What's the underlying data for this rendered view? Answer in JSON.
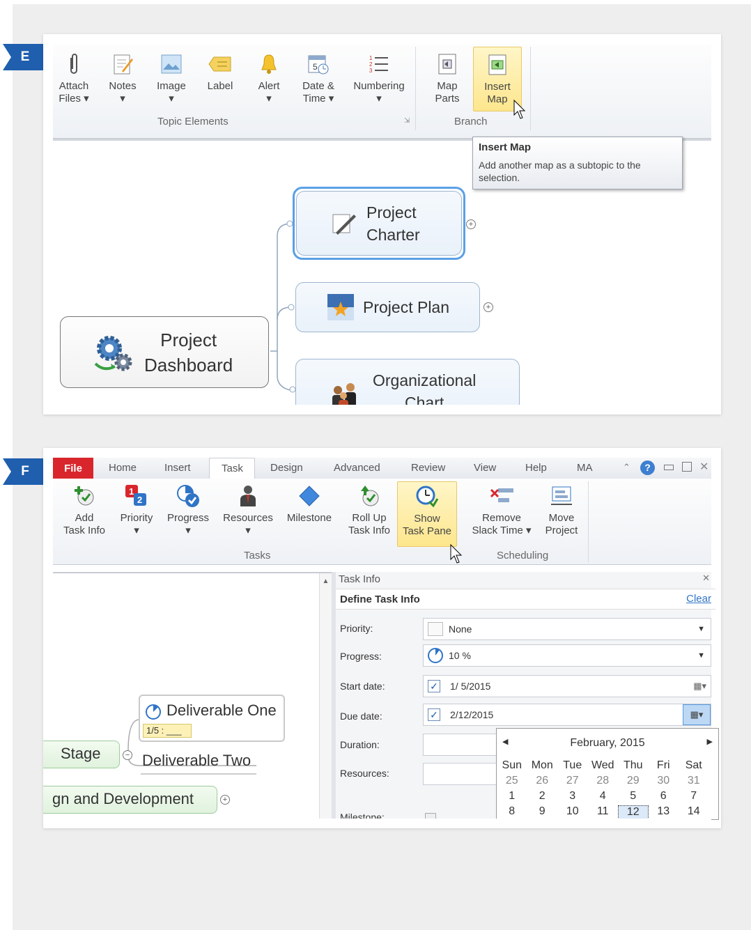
{
  "panel_e": {
    "tag": "E",
    "ribbon_buttons": [
      {
        "l1": "Attach",
        "l2": "Files ▾"
      },
      {
        "l1": "Notes",
        "l2": "▾"
      },
      {
        "l1": "Image",
        "l2": "▾"
      },
      {
        "l1": "Label",
        "l2": ""
      },
      {
        "l1": "Alert",
        "l2": "▾"
      },
      {
        "l1": "Date &",
        "l2": "Time ▾"
      },
      {
        "l1": "Numbering",
        "l2": "▾"
      },
      {
        "l1": "Map",
        "l2": "Parts"
      },
      {
        "l1": "Insert",
        "l2": "Map"
      }
    ],
    "group_topic_elements": "Topic Elements",
    "group_branch": "Branch",
    "tooltip_title": "Insert Map",
    "tooltip_line1": "Add another map as a subtopic to the",
    "tooltip_line2": "selection.",
    "topic_charter_1": "Project",
    "topic_charter_2": "Charter",
    "topic_plan": "Project Plan",
    "topic_dashboard_1": "Project",
    "topic_dashboard_2": "Dashboard",
    "topic_org_1": "Organizational",
    "topic_org_2": "Chart"
  },
  "panel_f": {
    "tag": "F",
    "tabs": [
      "File",
      "Home",
      "Insert",
      "Task",
      "Design",
      "Advanced",
      "Review",
      "View",
      "Help",
      "MA"
    ],
    "ribbon_buttons": [
      {
        "l1": "Add",
        "l2": "Task Info"
      },
      {
        "l1": "Priority",
        "l2": "▾"
      },
      {
        "l1": "Progress",
        "l2": "▾"
      },
      {
        "l1": "Resources",
        "l2": "▾"
      },
      {
        "l1": "Milestone",
        "l2": ""
      },
      {
        "l1": "Roll Up",
        "l2": "Task Info"
      },
      {
        "l1": "Show",
        "l2": "Task Pane"
      },
      {
        "l1": "Remove",
        "l2": "Slack Time ▾"
      },
      {
        "l1": "Move",
        "l2": "Project"
      }
    ],
    "group_tasks": "Tasks",
    "group_scheduling": "Scheduling",
    "pane_title": "Task Info",
    "pane_section": "Define Task Info",
    "pane_clear": "Clear",
    "fields": {
      "priority_label": "Priority:",
      "priority_value": "None",
      "progress_label": "Progress:",
      "progress_value": "10 %",
      "start_label": "Start date:",
      "start_value": "1/  5/2015",
      "due_label": "Due date:",
      "due_value": "2/12/2015",
      "duration_label": "Duration:",
      "resources_label": "Resources:",
      "milestone_label": "Milestone:"
    },
    "calendar": {
      "month": "February, 2015",
      "days": [
        "Sun",
        "Mon",
        "Tue",
        "Wed",
        "Thu",
        "Fri",
        "Sat"
      ],
      "week1": [
        "25",
        "26",
        "27",
        "28",
        "29",
        "30",
        "31"
      ],
      "week2": [
        "1",
        "2",
        "3",
        "4",
        "5",
        "6",
        "7"
      ],
      "week3": [
        "8",
        "9",
        "10",
        "11",
        "12",
        "13",
        "14"
      ]
    },
    "map": {
      "deliverable_one": "Deliverable One",
      "progress_badge": "1/5 : ___",
      "stage": "Stage",
      "deliverable_two": "Deliverable Two",
      "design_dev": "gn and Development"
    }
  }
}
